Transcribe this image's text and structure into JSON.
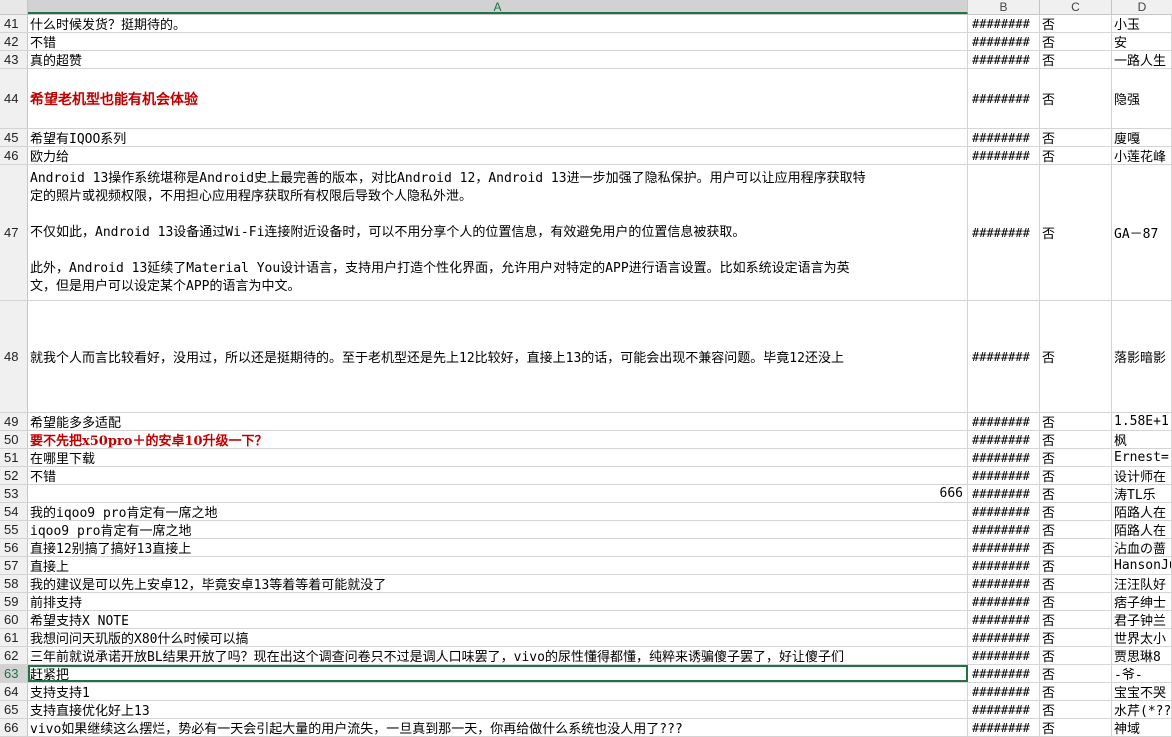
{
  "columns": {
    "A": "A",
    "B": "B",
    "C": "C",
    "D": "D"
  },
  "rows": [
    {
      "num": "41",
      "a": "什么时候发货？挺期待的。",
      "b": "########",
      "c": "否",
      "d": "小玉"
    },
    {
      "num": "42",
      "a": "不错",
      "b": "########",
      "c": "否",
      "d": "安"
    },
    {
      "num": "43",
      "a": "真的超赞",
      "b": "########",
      "c": "否",
      "d": "一路人生"
    },
    {
      "num": "44",
      "a": "希望老机型也能有机会体验",
      "b": "########",
      "c": "否",
      "d": "隐强"
    },
    {
      "num": "45",
      "a": "希望有IQOO系列",
      "b": "########",
      "c": "否",
      "d": "廋嘎"
    },
    {
      "num": "46",
      "a": "欧力给",
      "b": "########",
      "c": "否",
      "d": "小莲花峰"
    },
    {
      "num": "47",
      "a_lines": [
        "Android 13操作系统堪称是Android史上最完善的版本，对比Android 12，Android 13进一步加强了隐私保护。用户可以让应用程序获取特",
        "定的照片或视频权限，不用担心应用程序获取所有权限后导致个人隐私外泄。",
        "",
        "不仅如此，Android 13设备通过Wi-Fi连接附近设备时，可以不用分享个人的位置信息，有效避免用户的位置信息被获取。",
        "",
        "此外，Android 13延续了Material You设计语言，支持用户打造个性化界面，允许用户对特定的APP进行语言设置。比如系统设定语言为英",
        "文，但是用户可以设定某个APP的语言为中文。"
      ],
      "b": "########",
      "c": "否",
      "d": "GA－87"
    },
    {
      "num": "48",
      "a": "就我个人而言比较看好，没用过，所以还是挺期待的。至于老机型还是先上12比较好，直接上13的话，可能会出现不兼容问题。毕竟12还没上",
      "b": "########",
      "c": "否",
      "d": "落影暗影"
    },
    {
      "num": "49",
      "a": "希望能多多适配",
      "b": "########",
      "c": "否",
      "d": "1.58E+1"
    },
    {
      "num": "50",
      "a": "要不先把x50pro＋的安卓10升级一下？",
      "b": "########",
      "c": "否",
      "d": "枫"
    },
    {
      "num": "51",
      "a": "在哪里下载",
      "b": "########",
      "c": "否",
      "d": "Ernest="
    },
    {
      "num": "52",
      "a": "不错",
      "b": "########",
      "c": "否",
      "d": "设计师在"
    },
    {
      "num": "53",
      "a": "666",
      "b": "########",
      "c": "否",
      "d": "涛TL乐"
    },
    {
      "num": "54",
      "a": "我的iqoo9 pro肯定有一席之地",
      "b": "########",
      "c": "否",
      "d": "陌路人在"
    },
    {
      "num": "55",
      "a": "iqoo9 pro肯定有一席之地",
      "b": "########",
      "c": "否",
      "d": "陌路人在"
    },
    {
      "num": "56",
      "a": "直接12别搞了搞好13直接上",
      "b": "########",
      "c": "否",
      "d": "沾血の蔷"
    },
    {
      "num": "57",
      "a": "直接上",
      "b": "########",
      "c": "否",
      "d": "HansonJu"
    },
    {
      "num": "58",
      "a": "我的建议是可以先上安卓12，毕竟安卓13等着等着可能就没了",
      "b": "########",
      "c": "否",
      "d": "汪汪队好"
    },
    {
      "num": "59",
      "a": "前排支持",
      "b": "########",
      "c": "否",
      "d": "痞子绅士"
    },
    {
      "num": "60",
      "a": "希望支持X NOTE",
      "b": "########",
      "c": "否",
      "d": "君子钟兰"
    },
    {
      "num": "61",
      "a": "我想问问天玑版的X80什么时候可以搞",
      "b": "########",
      "c": "否",
      "d": "世界太小"
    },
    {
      "num": "62",
      "a": "三年前就说承诺开放BL结果开放了吗？现在出这个调查问卷只不过是调人口味罢了，vivo的尿性懂得都懂，纯粹来诱骗傻子罢了，好让傻子们",
      "b": "########",
      "c": "否",
      "d": "贾思琳8"
    },
    {
      "num": "63",
      "a": "赶紧把",
      "b": "########",
      "c": "否",
      "d": "-爷-"
    },
    {
      "num": "64",
      "a": "支持支持1",
      "b": "########",
      "c": "否",
      "d": "宝宝不哭"
    },
    {
      "num": "65",
      "a": "支持直接优化好上13",
      "b": "########",
      "c": "否",
      "d": "水芹(*??"
    },
    {
      "num": "66",
      "a": "vivo如果继续这么摆烂，势必有一天会引起大量的用户流失，一旦真到那一天，你再给做什么系统也没人用了???",
      "b": "########",
      "c": "否",
      "d": "神域"
    }
  ]
}
